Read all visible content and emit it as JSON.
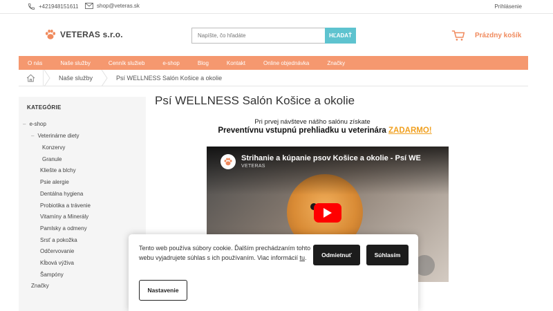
{
  "topbar": {
    "phone": "+421948151611",
    "email": "shop@veteras.sk",
    "login": "Prihlásenie"
  },
  "header": {
    "logo_text": "VETERAS s.r.o.",
    "search_placeholder": "Napíšte, čo hľadáte",
    "search_button": "HĽADAŤ",
    "cart_label": "Prázdny košík"
  },
  "nav": {
    "items": [
      "O nás",
      "Naše služby",
      "Cenník služieb",
      "e-shop",
      "Blog",
      "Kontakt",
      "Online objednávka",
      "Značky"
    ]
  },
  "breadcrumb": {
    "items": [
      "Naše služby",
      "Psí WELLNESS Salón Košice a okolie"
    ]
  },
  "sidebar": {
    "heading": "KATEGÓRIE",
    "categories": [
      {
        "label": "e-shop",
        "dash": "–"
      },
      {
        "label": "Veterinárne diety",
        "dash": "–"
      },
      {
        "label": "Konzervy",
        "dash": ""
      },
      {
        "label": "Granule",
        "dash": ""
      },
      {
        "label": "Kliešte a blchy",
        "dash": ""
      },
      {
        "label": "Psie alergie",
        "dash": ""
      },
      {
        "label": "Dentálna hygiena",
        "dash": ""
      },
      {
        "label": "Probiotika a trávenie",
        "dash": ""
      },
      {
        "label": "Vitamíny a Minerály",
        "dash": ""
      },
      {
        "label": "Pamlsky a odmeny",
        "dash": ""
      },
      {
        "label": "Srsť a pokožka",
        "dash": ""
      },
      {
        "label": "Odčervovanie",
        "dash": ""
      },
      {
        "label": "Kĺbová výživa",
        "dash": ""
      },
      {
        "label": "Šampóny",
        "dash": ""
      },
      {
        "label": "Značky",
        "dash": ""
      }
    ]
  },
  "main": {
    "title": "Psí WELLNESS Salón Košice a okolie",
    "intro": "Pri prvej návšteve nášho salónu získate",
    "promo_text": "Preventívnu vstupnú prehliadku u veterinára ",
    "promo_highlight": "ZADARMO!",
    "video_title": "Strihanie a kúpanie psov Košice a okolie - Psí WE",
    "video_channel": "VETERAS"
  },
  "cookie": {
    "text": "Tento web používa súbory cookie. Ďalším prechádzaním tohto webu vyjadrujete súhlas s ich používaním. Viac informácií ",
    "link": "tu",
    "text_end": ".",
    "reject": "Odmietnuť",
    "accept": "Súhlasím",
    "settings": "Nastavenie"
  },
  "colors": {
    "accent": "#f5986f",
    "search_button": "#5ec3cf",
    "promo_highlight": "#f0a020",
    "cart_label": "#f08a5d"
  }
}
